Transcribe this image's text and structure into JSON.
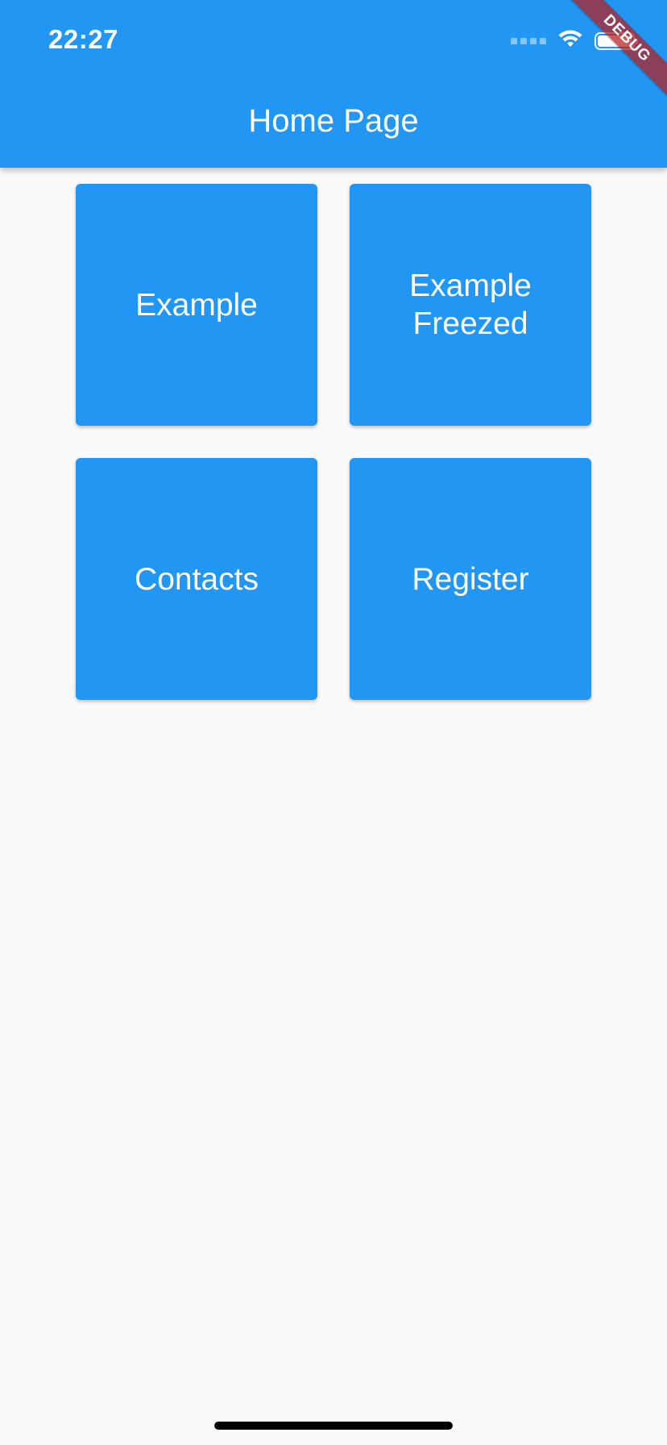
{
  "status_bar": {
    "time": "22:27",
    "icons": [
      "signal-icon",
      "wifi-icon",
      "battery-icon"
    ]
  },
  "app_bar": {
    "title": "Home Page"
  },
  "debug_banner": {
    "label": "DEBUG"
  },
  "tiles": [
    {
      "label": "Example"
    },
    {
      "label": "Example Freezed"
    },
    {
      "label": "Contacts"
    },
    {
      "label": "Register"
    }
  ],
  "colors": {
    "primary": "#2196f3",
    "background": "#fafafa",
    "banner": "#b71c1c",
    "text_on_primary": "#ffffff"
  }
}
